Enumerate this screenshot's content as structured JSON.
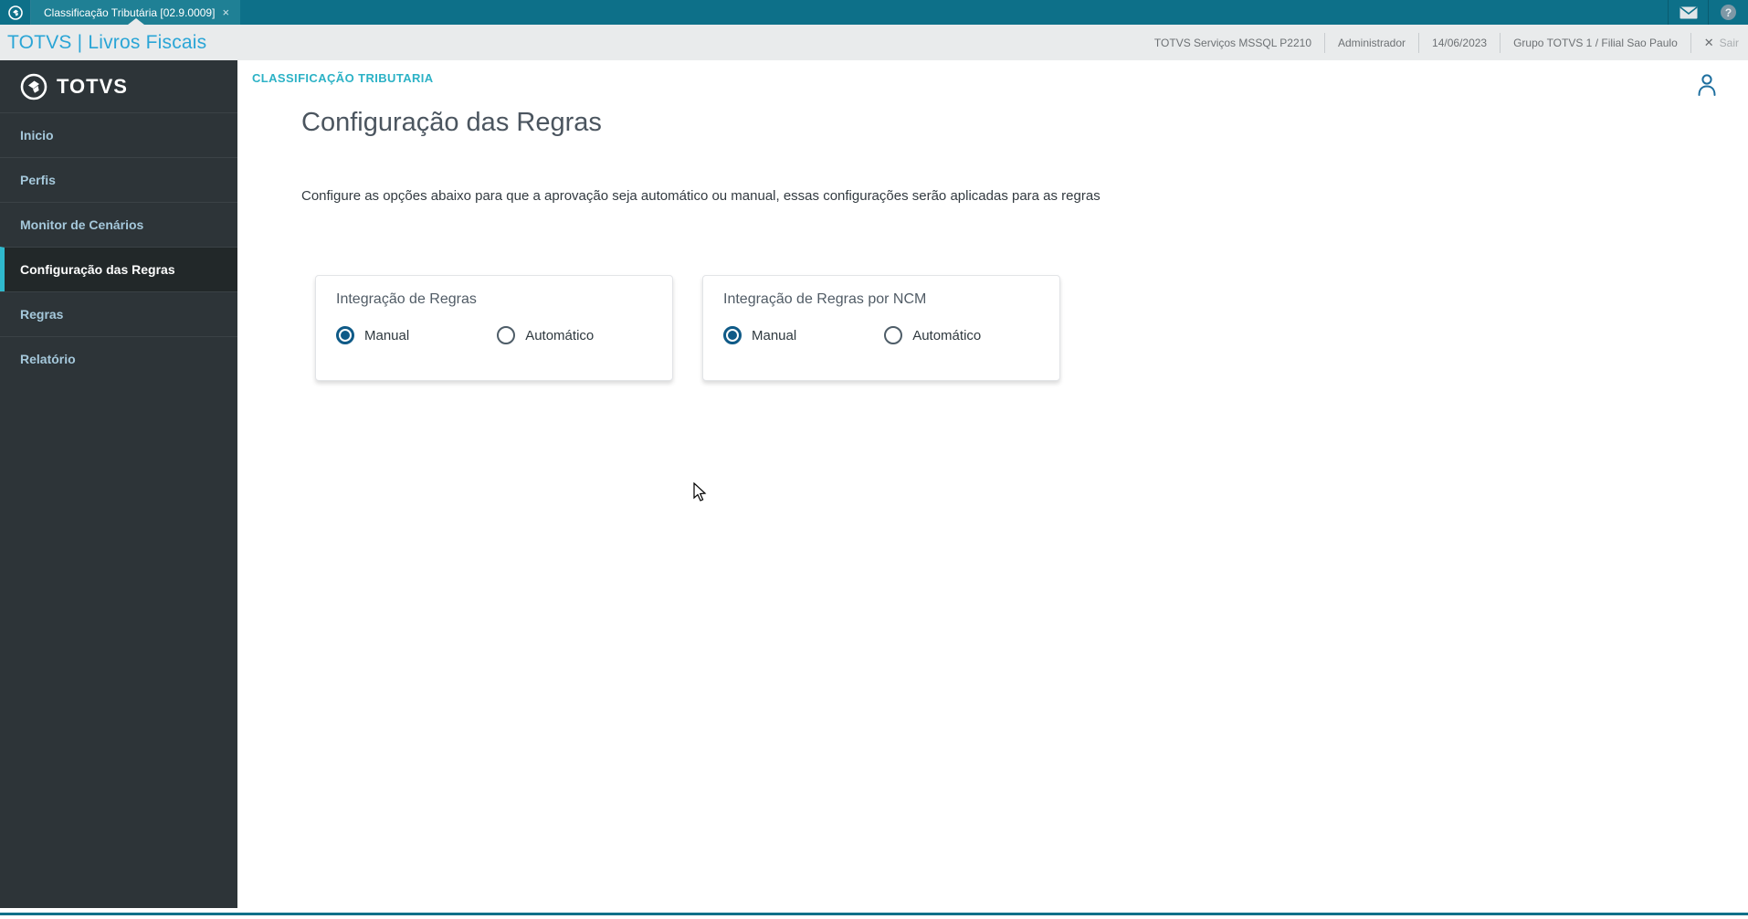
{
  "tabbar": {
    "tab_title": "Classificação Tributária [02.9.0009]",
    "close_label": "×"
  },
  "header": {
    "brand": "TOTVS | Livros Fiscais",
    "environment": "TOTVS Serviços MSSQL P2210",
    "user_role": "Administrador",
    "date": "14/06/2023",
    "company": "Grupo TOTVS 1 / Filial Sao Paulo",
    "logout_x": "✕",
    "logout_label": "Sair"
  },
  "sidebar": {
    "logo_text": "TOTVS",
    "items": [
      {
        "label": "Inicio",
        "active": false
      },
      {
        "label": "Perfis",
        "active": false
      },
      {
        "label": "Monitor de Cenários",
        "active": false
      },
      {
        "label": "Configuração das Regras",
        "active": true
      },
      {
        "label": "Regras",
        "active": false
      },
      {
        "label": "Relatório",
        "active": false
      }
    ]
  },
  "content": {
    "breadcrumb": "CLASSIFICAÇÃO TRIBUTARIA",
    "title": "Configuração das Regras",
    "description": "Configure as opções abaixo para que a aprovação seja automático ou manual, essas configurações serão aplicadas para as regras",
    "cards": [
      {
        "title": "Integração de Regras",
        "options": [
          {
            "label": "Manual",
            "selected": true
          },
          {
            "label": "Automático",
            "selected": false
          }
        ]
      },
      {
        "title": "Integração de Regras por NCM",
        "options": [
          {
            "label": "Manual",
            "selected": true
          },
          {
            "label": "Automático",
            "selected": false
          }
        ]
      }
    ]
  },
  "icons": {
    "mail": "mail-icon",
    "help": "?",
    "person": "user-icon"
  },
  "colors": {
    "topbar_teal": "#0d7089",
    "tab_bg": "#1f8095",
    "header_bg": "#e9ebec",
    "brand_blue": "#2aa5d6",
    "sidebar_bg": "#2d3438",
    "sidebar_active_accent": "#2fb9cd",
    "breadcrumb_cyan": "#2cb2c6",
    "radio_selected_blue": "#0f5a87"
  }
}
